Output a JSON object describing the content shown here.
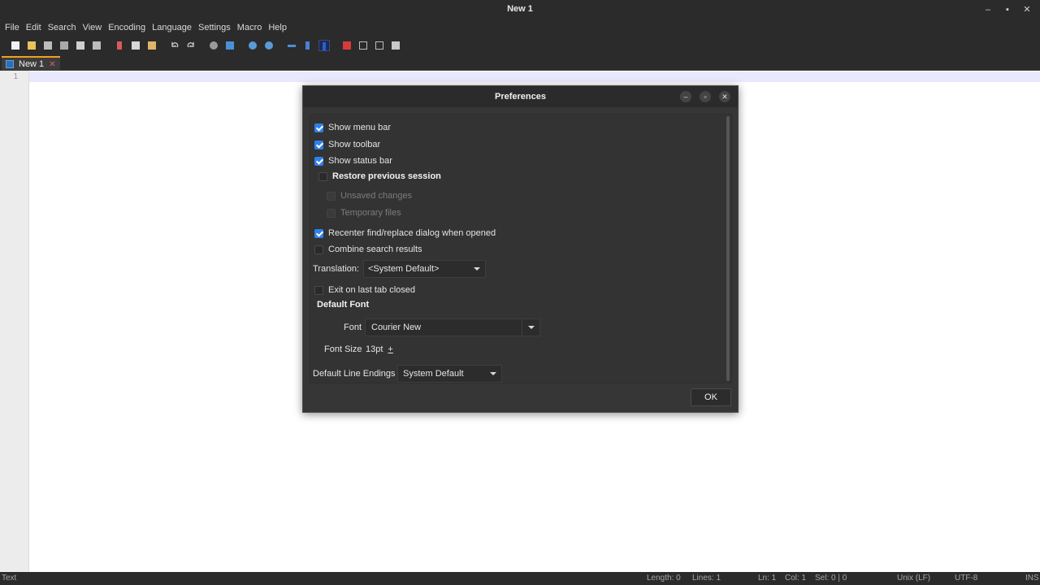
{
  "window": {
    "title": "New 1"
  },
  "menu": [
    "File",
    "Edit",
    "Search",
    "View",
    "Encoding",
    "Language",
    "Settings",
    "Macro",
    "Help"
  ],
  "toolbar_icons": [
    "new-file-icon",
    "open-file-icon",
    "save-icon",
    "save-all-icon",
    "close-icon",
    "close-all-icon",
    "cut-icon",
    "copy-icon",
    "paste-icon",
    "undo-icon",
    "redo-icon",
    "find-icon",
    "replace-icon",
    "zoom-in-icon",
    "zoom-out-icon",
    "wrap-icon",
    "show-all-chars-icon",
    "indent-guide-icon",
    "record-macro-icon",
    "stop-macro-icon",
    "play-macro-icon",
    "run-macro-multiple-icon"
  ],
  "tab": {
    "label": "New 1",
    "close": "✕"
  },
  "editor": {
    "line_number": "1"
  },
  "status": {
    "type": "Text",
    "length": "Length: 0",
    "lines": "Lines: 1",
    "ln": "Ln: 1",
    "col": "Col: 1",
    "sel": "Sel: 0 | 0",
    "eol": "Unix (LF)",
    "encoding": "UTF-8",
    "mode": "INS"
  },
  "dialog": {
    "title": "Preferences",
    "show_menu_bar": {
      "label": "Show menu bar",
      "checked": true
    },
    "show_toolbar": {
      "label": "Show toolbar",
      "checked": true
    },
    "show_status_bar": {
      "label": "Show status bar",
      "checked": true
    },
    "restore_session": {
      "label": "Restore previous session",
      "checked": false
    },
    "unsaved_changes": {
      "label": "Unsaved changes",
      "checked": false
    },
    "temporary_files": {
      "label": "Temporary files",
      "checked": false
    },
    "recenter_find": {
      "label": "Recenter find/replace dialog when opened",
      "checked": true
    },
    "combine_search": {
      "label": "Combine search results",
      "checked": false
    },
    "translation": {
      "label": "Translation:",
      "value": "<System Default>"
    },
    "exit_last_tab": {
      "label": "Exit on last tab closed",
      "checked": false
    },
    "default_font_heading": "Default Font",
    "font": {
      "label": "Font",
      "value": "Courier New"
    },
    "font_size": {
      "label": "Font Size",
      "value": "13pt",
      "stepper": "+"
    },
    "line_endings": {
      "label": "Default Line Endings",
      "value": "System Default"
    },
    "ok_label": "OK"
  },
  "colors": {
    "accent": "#2f80ed",
    "tab_accent": "#f0a020",
    "chrome": "#2b2b2b"
  }
}
